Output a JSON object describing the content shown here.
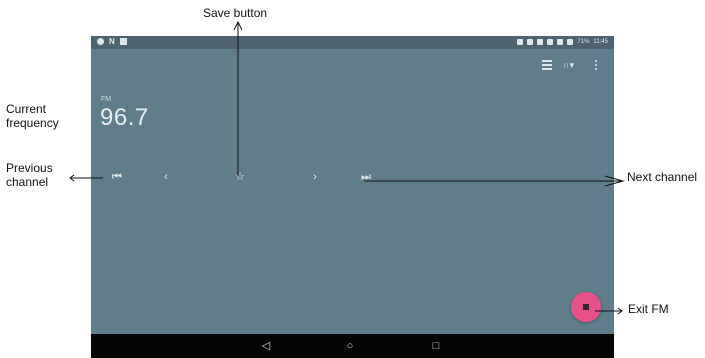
{
  "annotations": {
    "save": "Save button",
    "current_frequency": "Current frequency",
    "previous_channel": "Previous channel",
    "next_channel": "Next channel",
    "exit_fm": "Exit FM"
  },
  "status_bar": {
    "battery": "71%",
    "time": "11:45"
  },
  "radio": {
    "band": "FM",
    "frequency": "96.7"
  },
  "icons": {
    "previous_channel": "skip-previous-icon",
    "previous_step": "chevron-left-icon",
    "save": "star-outline-icon",
    "next_step": "chevron-right-icon",
    "next_channel": "skip-next-icon",
    "station_list": "list-icon",
    "audio_output": "headset-icon",
    "more": "more-vertical-icon",
    "exit": "stop-icon"
  },
  "colors": {
    "screen_bg": "#607d8b",
    "status_bar": "#4d6470",
    "fab": "#e8508a",
    "nav_bar": "#050505"
  }
}
